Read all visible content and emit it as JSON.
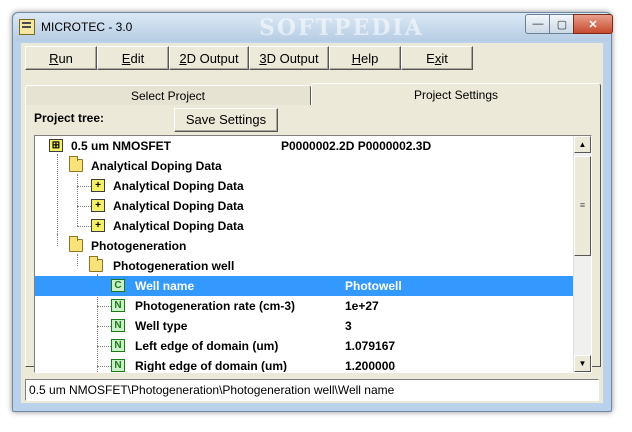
{
  "window": {
    "title": "MICROTEC - 3.0",
    "watermark": "SOFTPEDIA",
    "controls": {
      "minimize": "—",
      "maximize": "▢",
      "close": "✕"
    }
  },
  "toolbar": {
    "buttons": [
      {
        "label": "Run",
        "underline": "R"
      },
      {
        "label": "Edit",
        "underline": "E"
      },
      {
        "label": "2D Output",
        "underline": "2"
      },
      {
        "label": "3D Output",
        "underline": "3"
      },
      {
        "label": "Help",
        "underline": "H"
      },
      {
        "label": "Exit",
        "underline": "x"
      }
    ]
  },
  "tabs": [
    {
      "label": "Select Project",
      "active": false
    },
    {
      "label": "Project Settings",
      "active": true
    }
  ],
  "panel": {
    "project_tree_label": "Project tree:",
    "save_button": "Save Settings"
  },
  "tree": {
    "rows": [
      {
        "text": "0.5 um NMOSFET",
        "value": "P0000002.2D   P0000002.3D",
        "icon": "root"
      },
      {
        "text": "Analytical Doping Data",
        "icon": "folder"
      },
      {
        "text": "Analytical Doping Data",
        "icon": "plus"
      },
      {
        "text": "Analytical Doping Data",
        "icon": "plus"
      },
      {
        "text": "Analytical Doping Data",
        "icon": "plus"
      },
      {
        "text": "Photogeneration",
        "icon": "folder"
      },
      {
        "text": "Photogeneration well",
        "icon": "folder"
      },
      {
        "text": "Well name",
        "value": "Photowell",
        "icon": "C",
        "selected": true
      },
      {
        "text": "Photogeneration rate (cm-3)",
        "value": "1e+27",
        "icon": "N"
      },
      {
        "text": "Well type",
        "value": "3",
        "icon": "N"
      },
      {
        "text": "Left edge of domain (um)",
        "value": "1.079167",
        "icon": "N"
      },
      {
        "text": "Right edge of domain (um)",
        "value": "1.200000",
        "icon": "N"
      }
    ]
  },
  "status_bar": {
    "path": "0.5 um NMOSFET\\Photogeneration\\Photogeneration well\\Well name"
  },
  "colors": {
    "selection": "#3399ff",
    "titlebar": "#b9d1ea",
    "face": "#ece9d8"
  }
}
